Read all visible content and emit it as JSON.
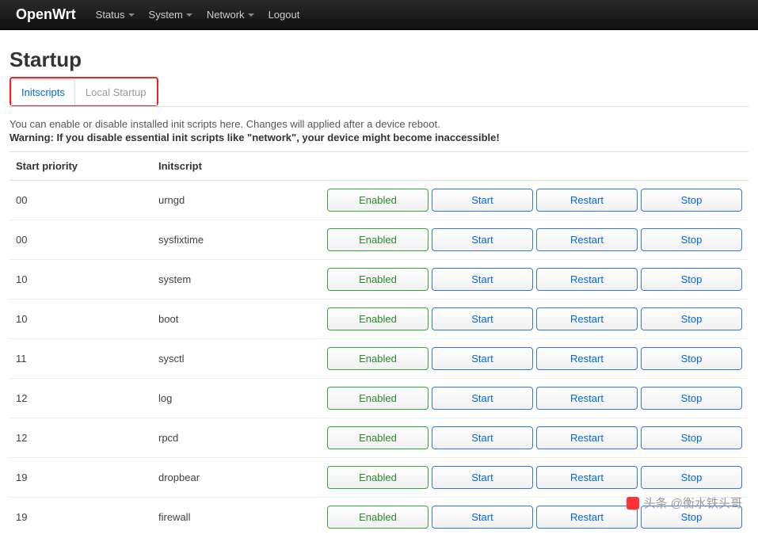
{
  "navbar": {
    "brand": "OpenWrt",
    "items": [
      {
        "label": "Status",
        "dropdown": true
      },
      {
        "label": "System",
        "dropdown": true
      },
      {
        "label": "Network",
        "dropdown": true
      },
      {
        "label": "Logout",
        "dropdown": false
      }
    ]
  },
  "page": {
    "title": "Startup"
  },
  "tabs": [
    {
      "label": "Initscripts",
      "active": true
    },
    {
      "label": "Local Startup",
      "active": false
    }
  ],
  "description": "You can enable or disable installed init scripts here. Changes will applied after a device reboot.",
  "warning": "Warning: If you disable essential init scripts like \"network\", your device might become inaccessible!",
  "table": {
    "headers": {
      "priority": "Start priority",
      "script": "Initscript"
    },
    "button_labels": {
      "enabled": "Enabled",
      "start": "Start",
      "restart": "Restart",
      "stop": "Stop"
    },
    "rows": [
      {
        "priority": "00",
        "script": "urngd"
      },
      {
        "priority": "00",
        "script": "sysfixtime"
      },
      {
        "priority": "10",
        "script": "system"
      },
      {
        "priority": "10",
        "script": "boot"
      },
      {
        "priority": "11",
        "script": "sysctl"
      },
      {
        "priority": "12",
        "script": "log"
      },
      {
        "priority": "12",
        "script": "rpcd"
      },
      {
        "priority": "19",
        "script": "dropbear"
      },
      {
        "priority": "19",
        "script": "firewall"
      }
    ]
  },
  "watermark": "头条 @衡水铁头哥"
}
